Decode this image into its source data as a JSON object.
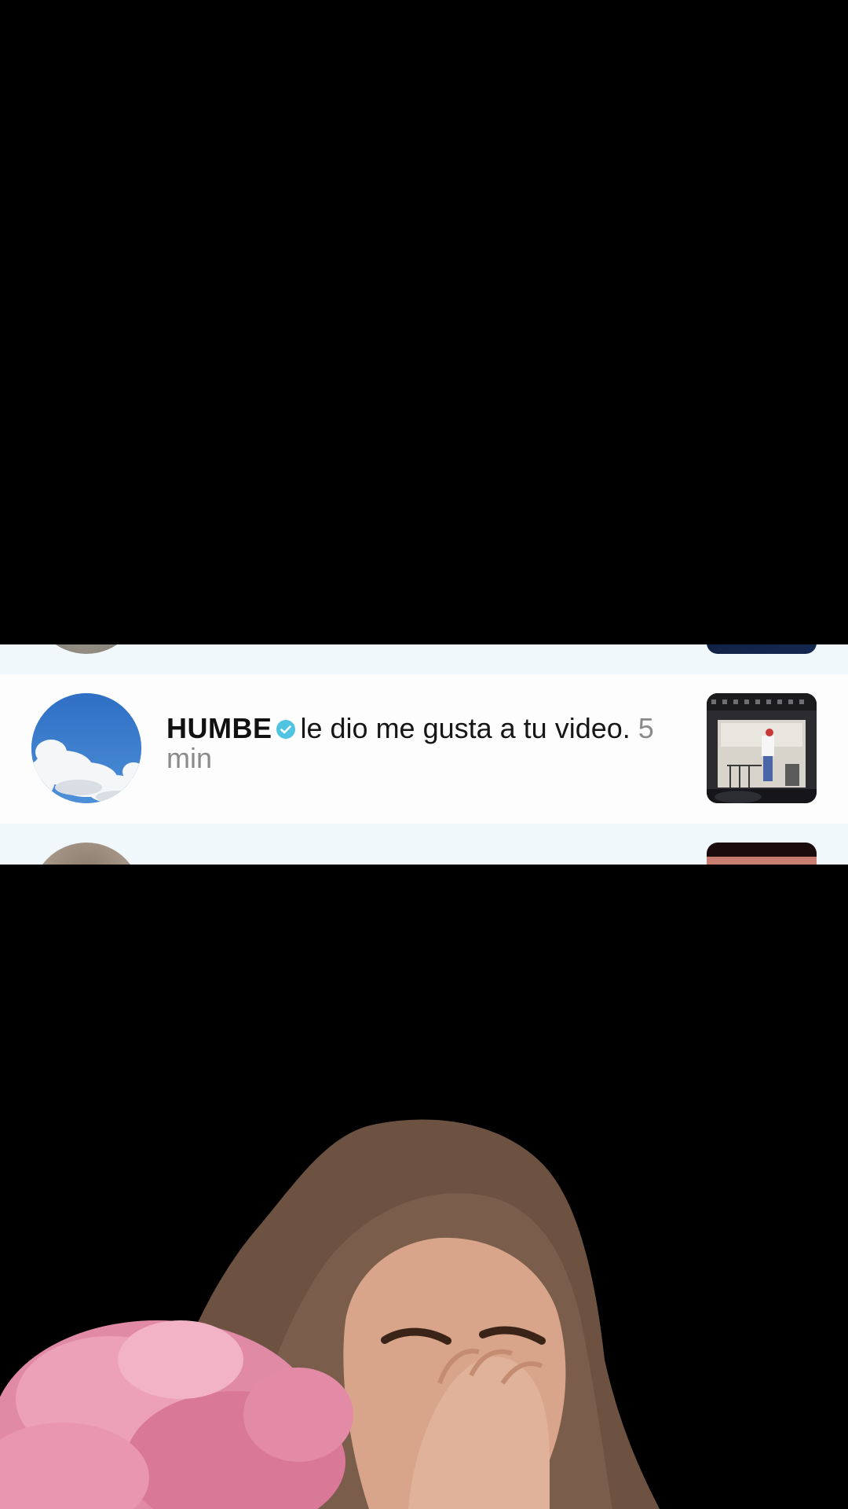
{
  "notification": {
    "username": "HUMBE",
    "message": "le dio me gusta a tu video.",
    "time": "5 min",
    "icons": {
      "verified": "verified-badge-icon",
      "avatar": "avatar-sky-clouds",
      "thumbnail": "video-thumbnail"
    }
  },
  "colors": {
    "background": "#000000",
    "row_background": "#fdfdfd",
    "strip_background": "#eef7fa",
    "verified_badge": "#4fc3e0",
    "time_text": "#8a8a8a"
  }
}
